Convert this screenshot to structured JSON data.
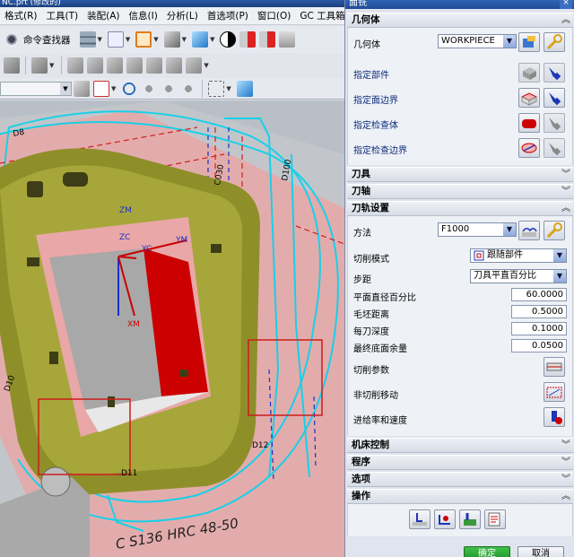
{
  "left_window": {
    "title_fragment": "NC.prt  (修改的)",
    "menu": [
      "格式(R)",
      "工具(T)",
      "装配(A)",
      "信息(I)",
      "分析(L)",
      "首选项(P)",
      "窗口(O)",
      "GC 工具箱",
      "帮"
    ],
    "toolbar1_label": "命令查找器",
    "viewport_labels": {
      "zm": "ZM",
      "zc": "ZC",
      "yc": "YC",
      "ym": "YM",
      "xm": "XM",
      "stamp": "C S136 HRC 48-50",
      "d11": "D11",
      "d12": "D12",
      "d10": "D10",
      "d4_left": "D8",
      "c030": "C030",
      "d100": "D100"
    }
  },
  "dialog": {
    "title": "面铣",
    "close": "×",
    "sections": {
      "geometry": {
        "header": "几何体",
        "rows": {
          "geometry_label": "几何体",
          "geometry_value": "WORKPIECE",
          "part": "指定部件",
          "face_boundary": "指定面边界",
          "check_body": "指定检查体",
          "check_boundary": "指定检查边界"
        }
      },
      "tool": {
        "header": "刀具"
      },
      "axis": {
        "header": "刀轴"
      },
      "path_settings": {
        "header": "刀轨设置",
        "method_label": "方法",
        "method_value": "F1000",
        "cut_pattern_label": "切削模式",
        "cut_pattern_value": "跟随部件",
        "stepover_label": "步距",
        "stepover_value": "刀具平直百分比",
        "flat_pct_label": "平面直径百分比",
        "flat_pct_value": "60.0000",
        "blank_dist_label": "毛坯距离",
        "blank_dist_value": "0.5000",
        "depth_per_cut_label": "每刀深度",
        "depth_per_cut_value": "0.1000",
        "final_floor_label": "最终底面余量",
        "final_floor_value": "0.0500",
        "cut_params_label": "切削参数",
        "non_cut_label": "非切削移动",
        "feeds_label": "进给率和速度"
      },
      "machine_control": {
        "header": "机床控制"
      },
      "program": {
        "header": "程序"
      },
      "options": {
        "header": "选项"
      },
      "actions": {
        "header": "操作"
      }
    },
    "ok": "确定",
    "cancel": "取消"
  },
  "colors": {
    "accent_blue": "#1f4fa0",
    "toolpath_cyan": "#18d0e8",
    "part_olive": "#8f8f2a",
    "part_pink": "#e9a7a7",
    "highlight_red": "#cc1d1d"
  }
}
